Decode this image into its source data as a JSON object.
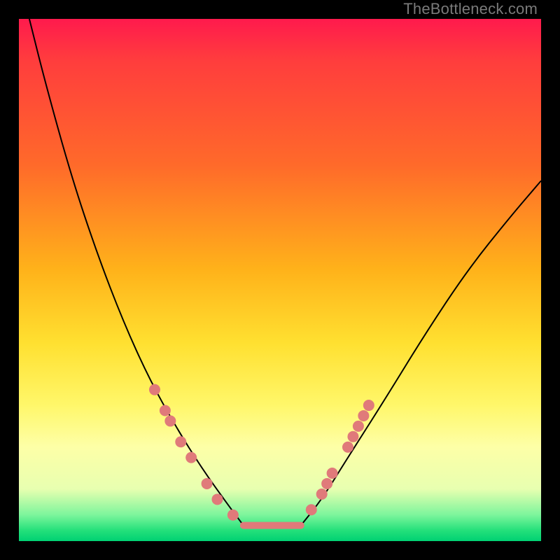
{
  "watermark": "TheBottleneck.com",
  "chart_data": {
    "type": "line",
    "title": "",
    "xlabel": "",
    "ylabel": "",
    "xlim": [
      0,
      100
    ],
    "ylim": [
      0,
      100
    ],
    "background_gradient": {
      "top": "#ff1a4d",
      "bottom": "#00d173",
      "stops": [
        "#ff1a4d",
        "#ff6a2a",
        "#ffe030",
        "#fdffa7",
        "#23e07a"
      ]
    },
    "series": [
      {
        "name": "left-curve",
        "x": [
          2,
          5,
          10,
          15,
          20,
          25,
          30,
          35,
          40,
          43
        ],
        "values": [
          100,
          88,
          70,
          55,
          42,
          31,
          22,
          14,
          7,
          3
        ]
      },
      {
        "name": "flat-minimum",
        "x": [
          43,
          54
        ],
        "values": [
          3,
          3
        ]
      },
      {
        "name": "right-curve",
        "x": [
          54,
          58,
          63,
          70,
          78,
          86,
          94,
          100
        ],
        "values": [
          3,
          8,
          16,
          27,
          40,
          52,
          62,
          69
        ]
      }
    ],
    "markers": {
      "left_dots": [
        {
          "x": 26,
          "y": 29
        },
        {
          "x": 28,
          "y": 25
        },
        {
          "x": 29,
          "y": 23
        },
        {
          "x": 31,
          "y": 19
        },
        {
          "x": 33,
          "y": 16
        },
        {
          "x": 36,
          "y": 11
        },
        {
          "x": 38,
          "y": 8
        },
        {
          "x": 41,
          "y": 5
        }
      ],
      "right_dots": [
        {
          "x": 56,
          "y": 6
        },
        {
          "x": 58,
          "y": 9
        },
        {
          "x": 59,
          "y": 11
        },
        {
          "x": 60,
          "y": 13
        },
        {
          "x": 63,
          "y": 18
        },
        {
          "x": 64,
          "y": 20
        },
        {
          "x": 65,
          "y": 22
        },
        {
          "x": 66,
          "y": 24
        },
        {
          "x": 67,
          "y": 26
        }
      ],
      "color": "#e07a7a",
      "radius": 8
    }
  }
}
